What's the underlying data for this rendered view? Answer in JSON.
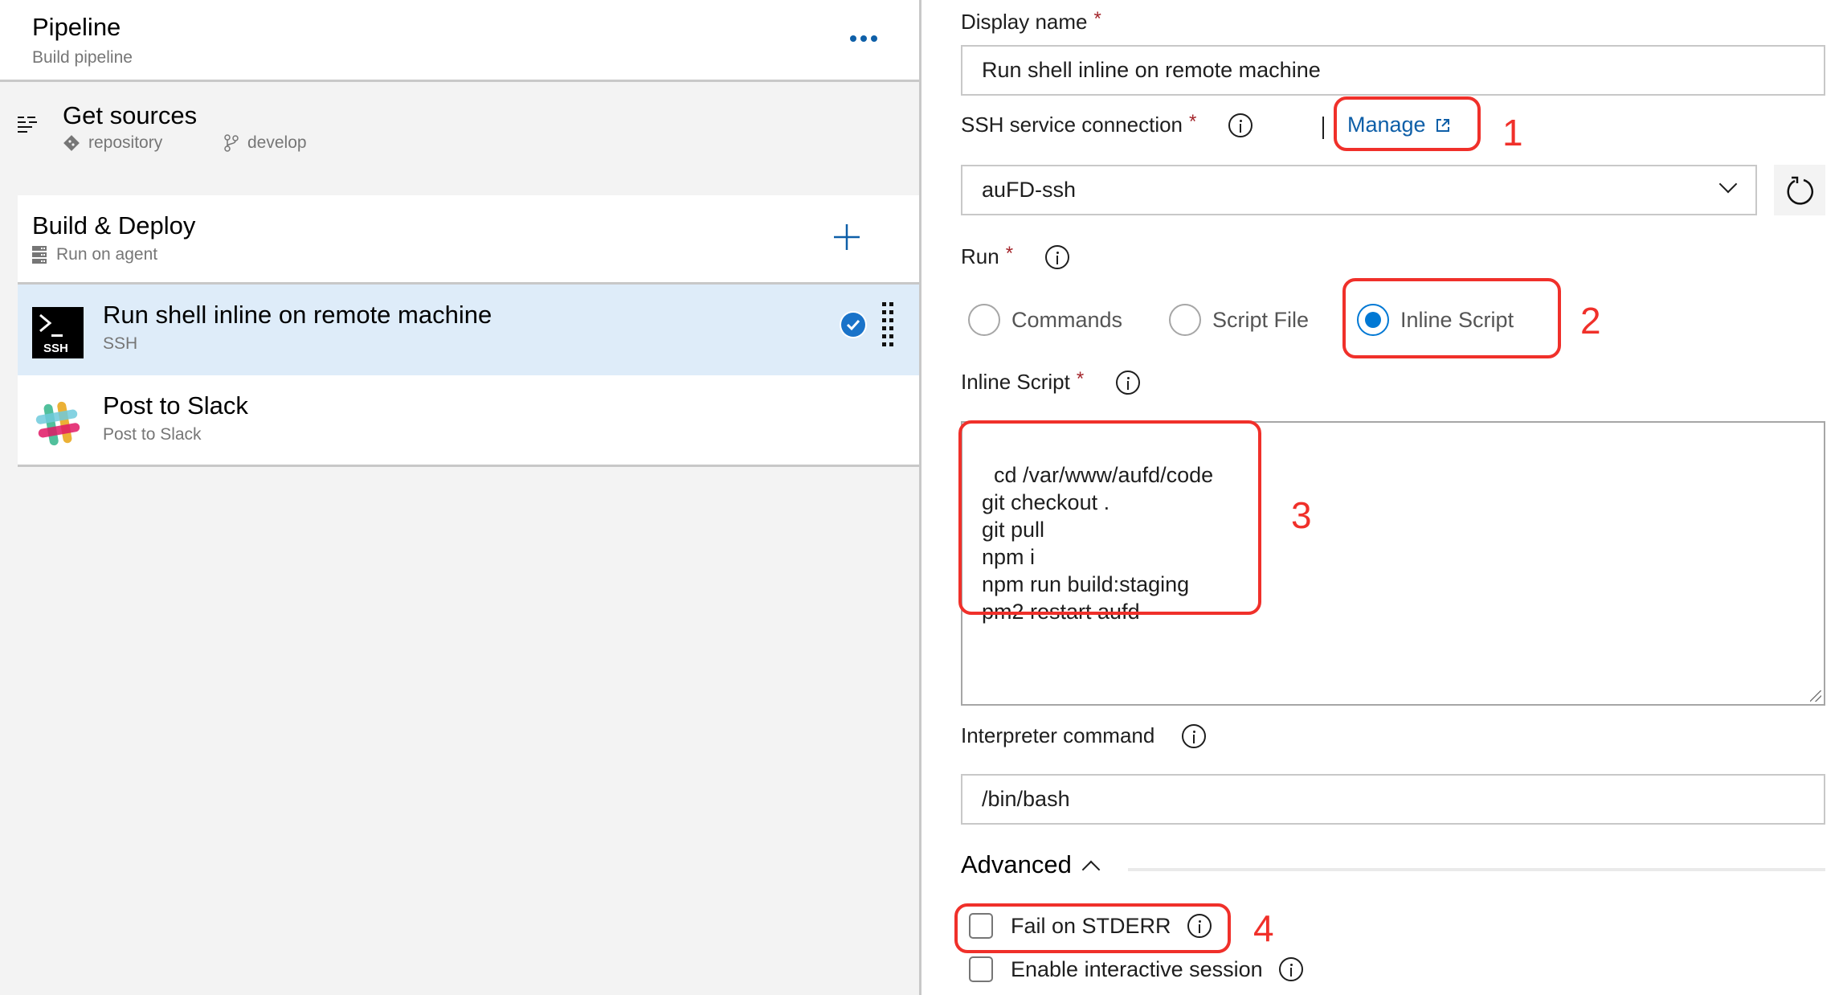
{
  "left_panel": {
    "header": {
      "title": "Pipeline",
      "subtitle": "Build pipeline",
      "more_icon": "ellipsis-icon"
    },
    "get_sources": {
      "title": "Get sources",
      "repository": "repository",
      "branch": "develop"
    },
    "job": {
      "title": "Build & Deploy",
      "subtitle": "Run on agent",
      "add_icon": "plus-icon"
    },
    "tasks": [
      {
        "title": "Run shell inline on remote machine",
        "subtitle": "SSH",
        "icon": "ssh-terminal-icon",
        "selected": true
      },
      {
        "title": "Post to Slack",
        "subtitle": "Post to Slack",
        "icon": "slack-icon",
        "selected": false
      }
    ]
  },
  "form": {
    "display_name": {
      "label": "Display name",
      "required": "*",
      "value": "Run shell inline on remote machine"
    },
    "ssh_connection": {
      "label": "SSH service connection",
      "required": "*",
      "manage_label": "Manage",
      "value": "auFD-ssh"
    },
    "run": {
      "label": "Run",
      "required": "*",
      "options": [
        "Commands",
        "Script File",
        "Inline Script"
      ],
      "selected": "Inline Script"
    },
    "inline_script": {
      "label": "Inline Script",
      "required": "*",
      "value": "cd /var/www/aufd/code\ngit checkout .\ngit pull\nnpm i\nnpm run build:staging\npm2 restart aufd"
    },
    "interpreter": {
      "label": "Interpreter command",
      "value": "/bin/bash"
    },
    "advanced": {
      "label": "Advanced",
      "fail_on_stderr": {
        "label": "Fail on STDERR",
        "checked": false
      },
      "interactive_session": {
        "label": "Enable interactive session",
        "checked": false
      }
    }
  },
  "annotations": [
    "1",
    "2",
    "3",
    "4"
  ],
  "colors": {
    "accent": "#0078d4",
    "link": "#0e5fa8",
    "selected_row": "#deecf9",
    "annotation": "#f0302a",
    "required": "#a4262c"
  }
}
